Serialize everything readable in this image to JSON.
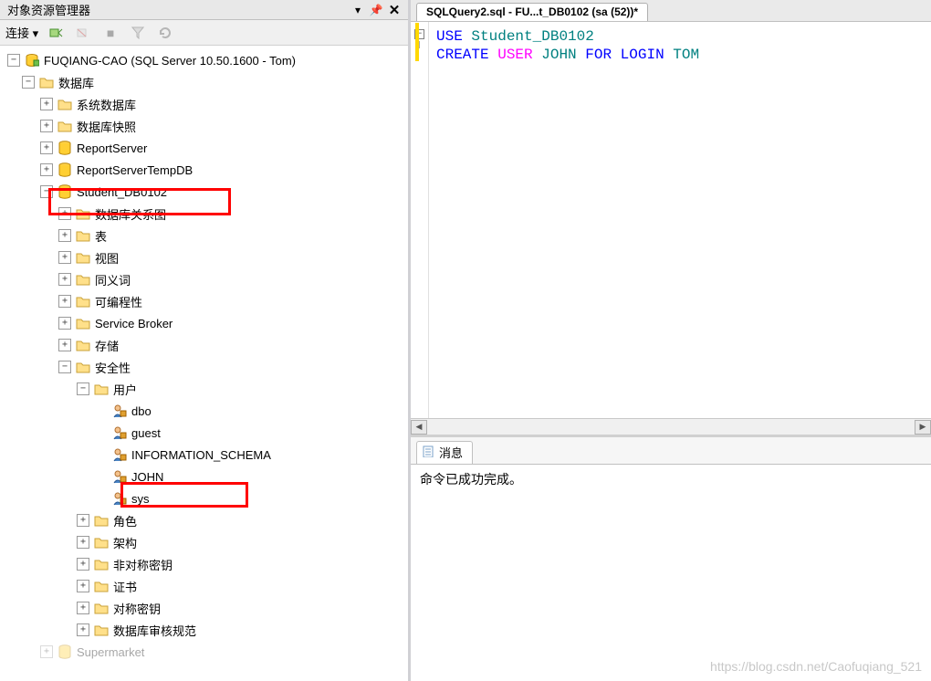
{
  "panel": {
    "title": "对象资源管理器",
    "toolbar_label": "连接 ▾"
  },
  "server": {
    "label": "FUQIANG-CAO (SQL Server 10.50.1600 - Tom)"
  },
  "tree": {
    "databases": "数据库",
    "sys_db": "系统数据库",
    "snapshots": "数据库快照",
    "report_server": "ReportServer",
    "report_server_temp": "ReportServerTempDB",
    "student_db": "Student_DB0102",
    "diagram": "数据库关系图",
    "tables": "表",
    "views": "视图",
    "synonyms": "同义词",
    "programmability": "可编程性",
    "service_broker": "Service Broker",
    "storage": "存储",
    "security": "安全性",
    "users": "用户",
    "user_dbo": "dbo",
    "user_guest": "guest",
    "user_info": "INFORMATION_SCHEMA",
    "user_john": "JOHN",
    "user_sys": "sys",
    "roles": "角色",
    "schemas": "架构",
    "asym_keys": "非对称密钥",
    "certs": "证书",
    "sym_keys": "对称密钥",
    "audit": "数据库审核规范",
    "supermarket": "Supermarket"
  },
  "tab": {
    "label": "SQLQuery2.sql - FU...t_DB0102 (sa (52))*"
  },
  "sql": {
    "kw_use": "USE",
    "db": "Student_DB0102",
    "kw_create": "CREATE",
    "kw_user": "USER",
    "user": "JOHN",
    "kw_for": "FOR",
    "kw_login": "LOGIN",
    "login": "TOM"
  },
  "messages": {
    "tab": "消息",
    "text": "命令已成功完成。"
  },
  "watermark": "https://blog.csdn.net/Caofuqiang_521"
}
